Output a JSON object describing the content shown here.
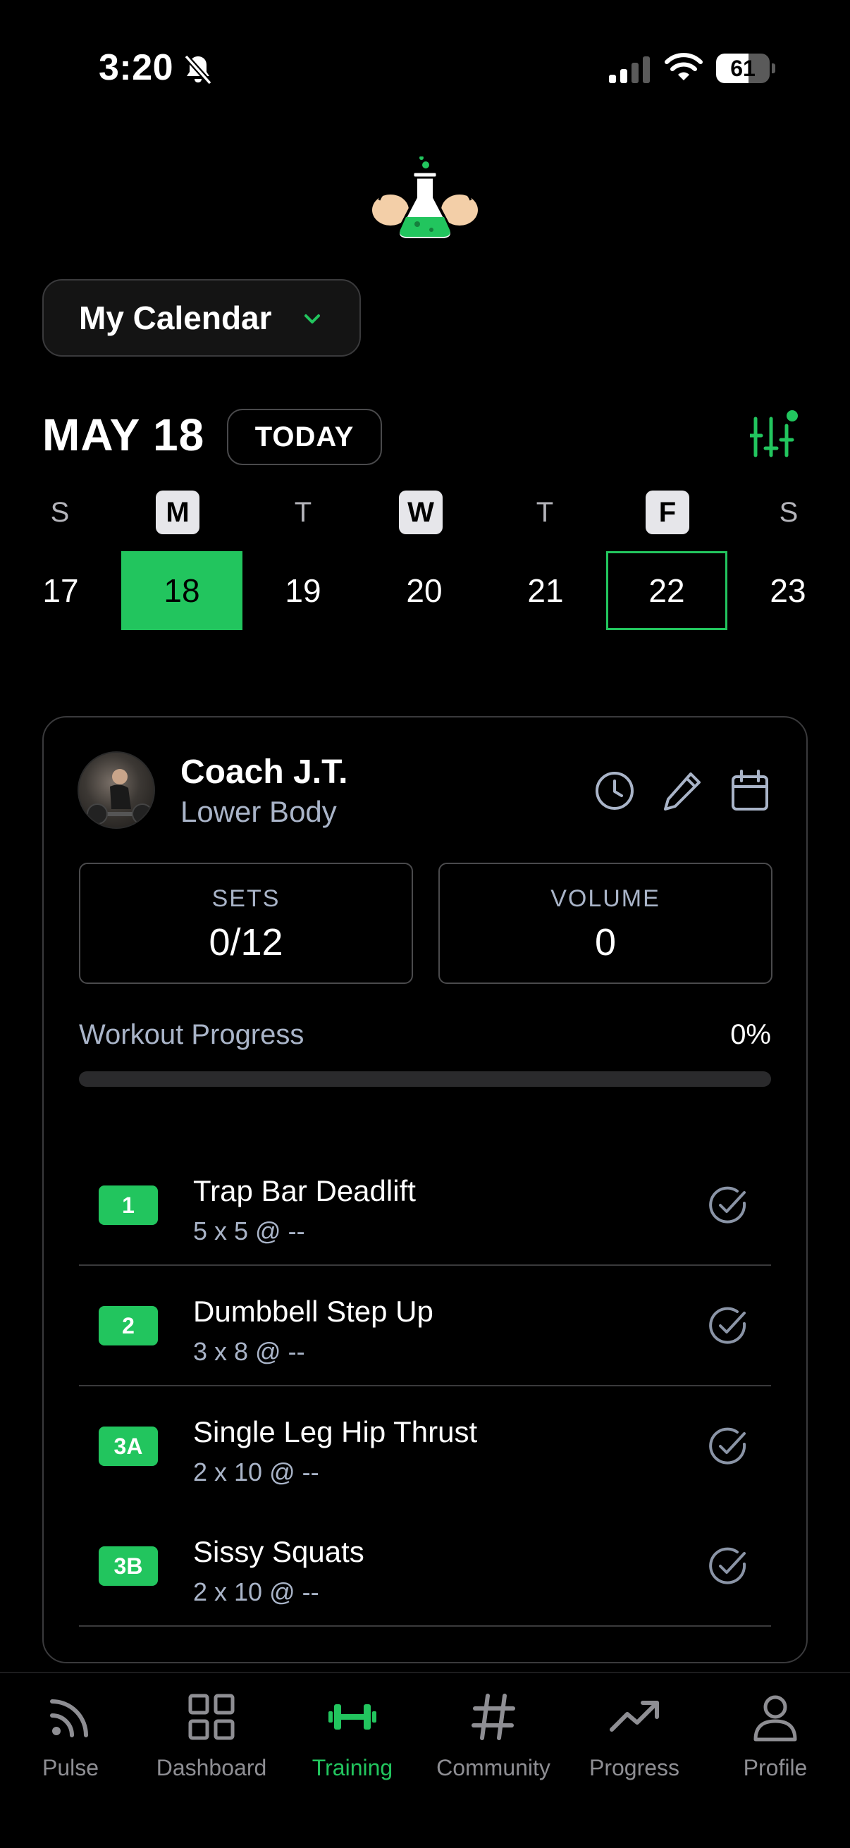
{
  "status_bar": {
    "time": "3:20",
    "battery": "61",
    "battery_level": 0.61
  },
  "calendar": {
    "selector_label": "My Calendar",
    "date_title": "MAY 18",
    "today_label": "TODAY",
    "weekdays": [
      "S",
      "M",
      "T",
      "W",
      "T",
      "F",
      "S"
    ],
    "days": [
      "17",
      "18",
      "19",
      "20",
      "21",
      "22",
      "23"
    ]
  },
  "workout": {
    "coach": "Coach J.T.",
    "name": "Lower Body",
    "sets_label": "SETS",
    "sets_value": "0/12",
    "volume_label": "VOLUME",
    "volume_value": "0",
    "progress_label": "Workout Progress",
    "progress_percent": "0%",
    "progress_fraction": 0,
    "exercises": [
      {
        "badge": "1",
        "name": "Trap Bar Deadlift",
        "detail": "5 x 5 @ --"
      },
      {
        "badge": "2",
        "name": "Dumbbell Step Up",
        "detail": "3 x 8 @ --"
      },
      {
        "badge": "3A",
        "name": "Single Leg Hip Thrust",
        "detail": "2 x 10 @ --"
      },
      {
        "badge": "3B",
        "name": "Sissy Squats",
        "detail": "2 x 10 @ --"
      }
    ]
  },
  "tabs": [
    {
      "label": "Pulse",
      "icon": "pulse-icon"
    },
    {
      "label": "Dashboard",
      "icon": "dashboard-icon"
    },
    {
      "label": "Training",
      "icon": "dumbbell-icon",
      "active": true
    },
    {
      "label": "Community",
      "icon": "hashtag-icon"
    },
    {
      "label": "Progress",
      "icon": "trend-icon"
    },
    {
      "label": "Profile",
      "icon": "person-icon"
    }
  ],
  "colors": {
    "accent": "#22c55e",
    "muted_text": "#a9b4c8",
    "background": "#000000"
  }
}
